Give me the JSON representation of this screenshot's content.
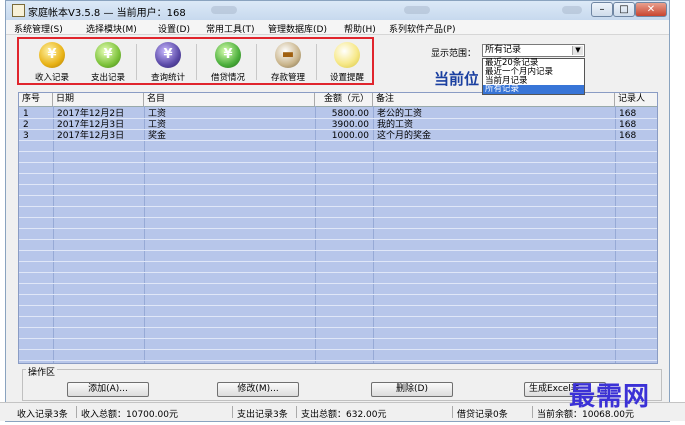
{
  "window": {
    "title": "家庭帐本V3.5.8 — 当前用户：168",
    "min_label": "–",
    "max_label": "□",
    "close_label": "✕"
  },
  "menu": [
    "系统管理(S)",
    "选择模块(M)",
    "设置(D)",
    "常用工具(T)",
    "管理数据库(D)",
    "帮助(H)",
    "系列软件产品(P)"
  ],
  "toolbar": [
    {
      "label": "收入记录",
      "icon": "income-yen-icon",
      "color": "#e8b215",
      "badge": "#2aa33a"
    },
    {
      "label": "支出记录",
      "icon": "expense-yen-icon",
      "color": "#7cc23a",
      "badge": "#2aa33a"
    },
    {
      "label": "查询统计",
      "icon": "query-stats-icon",
      "color": "#5b4aa8",
      "badge": "#e0a000"
    },
    {
      "label": "借贷情况",
      "icon": "loan-yen-icon",
      "color": "#4caf3c",
      "badge": "#d93a8a"
    },
    {
      "label": "存款管理",
      "icon": "deposit-icon",
      "color": "#c9b48a",
      "badge": "#e07a10"
    },
    {
      "label": "设置提醒",
      "icon": "reminder-bulb-icon",
      "color": "#f7e98a",
      "badge": "#d6c440"
    }
  ],
  "filter": {
    "label": "显示范围：",
    "selected": "所有记录",
    "options": [
      "最近20条记录",
      "最近一个月内记录",
      "当前月记录",
      "所有记录"
    ],
    "selected_index": 3
  },
  "current_position": "当前位",
  "table": {
    "columns": [
      "序号",
      "日期",
      "名目",
      "金额（元）",
      "备注",
      "记录人"
    ],
    "rows": [
      [
        "1",
        "2017年12月2日",
        "工资",
        "5800.00",
        "老公的工资",
        "168"
      ],
      [
        "2",
        "2017年12月3日",
        "工资",
        "3900.00",
        "我的工资",
        "168"
      ],
      [
        "3",
        "2017年12月3日",
        "奖金",
        "1000.00",
        "这个月的奖金",
        "168"
      ]
    ]
  },
  "operations": {
    "title": "操作区",
    "add": "添加(A)...",
    "edit": "修改(M)...",
    "delete": "删除(D)",
    "excel": "生成Excel表"
  },
  "status": {
    "income_count": "收入记录3条",
    "income_total": "收入总额：10700.00元",
    "expense_count": "支出记录3条",
    "expense_total": "支出总额：632.00元",
    "loan_count": "借贷记录0条",
    "balance": "当前余额：10068.00元"
  },
  "watermark": "最需网"
}
